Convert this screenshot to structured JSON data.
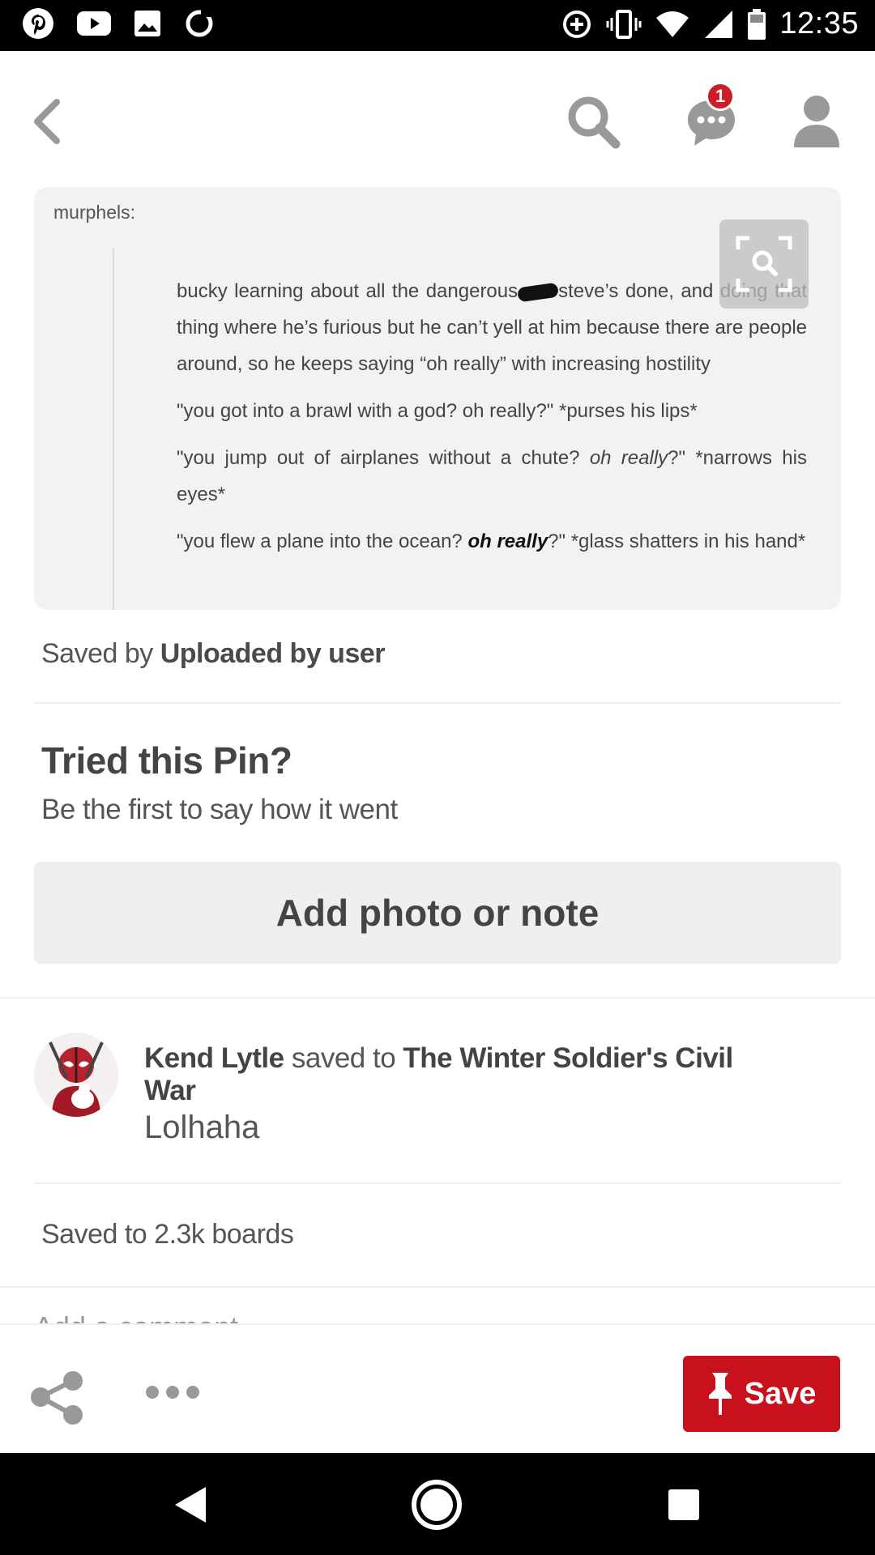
{
  "status_bar": {
    "time": "12:35",
    "left_icons": [
      "pinterest-icon",
      "youtube-icon",
      "gallery-icon",
      "sync-icon"
    ],
    "right_icons": [
      "data-saver-icon",
      "vibrate-icon",
      "wifi-icon",
      "signal-icon",
      "battery-icon"
    ]
  },
  "top_nav": {
    "message_badge": "1"
  },
  "pin": {
    "source": "murphels:",
    "lines": {
      "p1_start": "bucky learning about all the dangerous",
      "p1_end": "steve’s done, and doing that thing where he’s furious but he can’t yell at him because there are people around, so he keeps saying “oh really” with increasing hostility",
      "p2": "\"you got into a brawl with a god? oh really?\" *purses his lips*",
      "p3_start": "\"you jump out of airplanes without a chute?",
      "p3_em": "oh really",
      "p3_end": "?\" *narrows his eyes*",
      "p4_start": "\"you flew a plane into the ocean?",
      "p4_strong": "oh really",
      "p4_end": "?\" *glass shatters in his hand*"
    }
  },
  "saved_by": {
    "prefix": "Saved by",
    "name": "Uploaded by user"
  },
  "tried": {
    "title": "Tried this Pin?",
    "subtitle": "Be the first to say how it went",
    "button": "Add photo or note"
  },
  "activity": {
    "user": "Kend Lytle",
    "verb": "saved to",
    "board": "The Winter Soldier's Civil War",
    "note": "Lolhaha"
  },
  "boards_count": "Saved to 2.3k boards",
  "comment_placeholder": "Add a comment",
  "action_bar": {
    "save_label": "Save"
  },
  "colors": {
    "brand_red": "#c8111c",
    "badge_red": "#cb1f27"
  }
}
